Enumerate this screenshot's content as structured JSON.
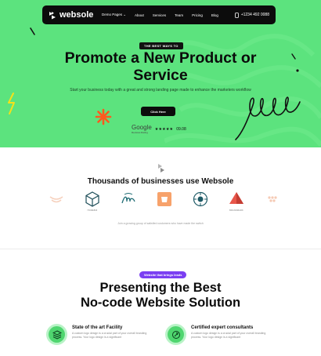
{
  "nav": {
    "brand": "websole",
    "links": [
      "Demo Pages ⌄",
      "About",
      "Services",
      "Team",
      "Pricing",
      "Blog"
    ],
    "phone": "+1234 492 0088"
  },
  "hero": {
    "badge": "THE BEST WAYS TO",
    "title_line1": "Promote a New Product or",
    "title_line2": "Service",
    "subtitle": "Start your business today with a great and strong landing page made to enhance the marketers workflow",
    "cta": "Click Here",
    "rating_brand": "Google",
    "rating_sub": "Reviews Rating",
    "stars": "★★★★★",
    "score": "09.08"
  },
  "clients": {
    "title": "Thousands of businesses use Websole",
    "logos": [
      {
        "icon": "wings-logo-icon",
        "caption": ""
      },
      {
        "icon": "cube-logo-icon",
        "caption": "HOMEBIZ"
      },
      {
        "icon": "script-logo-icon",
        "caption": ""
      },
      {
        "icon": "mug-logo-icon",
        "caption": ""
      },
      {
        "icon": "sun-badge-logo-icon",
        "caption": ""
      },
      {
        "icon": "pyramid-logo-icon",
        "caption": "BRANDMARK"
      },
      {
        "icon": "dots-logo-icon",
        "caption": ""
      }
    ],
    "note": "Join a growing group of satisfied customers who have made the switch"
  },
  "solution": {
    "pill": "Website that brings leads",
    "title_line1": "Presenting the Best",
    "title_line2": "No-code Website Solution",
    "features": [
      {
        "icon": "layers-icon",
        "title": "State of the art Facility",
        "desc": "A custom logo design is a crucial part of your overall branding process. Your logo design is a significant"
      },
      {
        "icon": "expert-icon",
        "title": "Certified expert consultants",
        "desc": "A custom logo design is a crucial part of your overall branding process. Your logo design is a significant"
      }
    ]
  },
  "colors": {
    "accent_green": "#5ce37e",
    "dark": "#0c0c0c",
    "purple": "#7b3ff2",
    "spark_orange": "#ff5a1f",
    "zig_yellow": "#f4e11a"
  }
}
